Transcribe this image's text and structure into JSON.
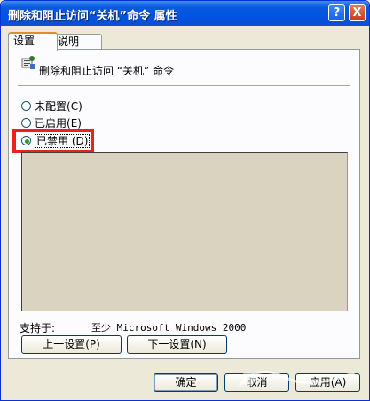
{
  "window": {
    "title": "删除和阻止访问“关机”命令 属性",
    "help_glyph": "?",
    "close_glyph": "X"
  },
  "tabs": [
    {
      "label": "设置",
      "active": true
    },
    {
      "label": "说明",
      "active": false
    }
  ],
  "policy": {
    "icon": "policy-setting-icon",
    "name": "删除和阻止访问 “关机” 命令"
  },
  "options": [
    {
      "label": "未配置",
      "accel": "(C)",
      "selected": false
    },
    {
      "label": "已启用",
      "accel": "(E)",
      "selected": false
    },
    {
      "label": "已禁用",
      "accel": "(D)",
      "selected": true
    }
  ],
  "support": {
    "label": "支持于:",
    "value": "至少 Microsoft Windows 2000"
  },
  "nav_buttons": {
    "prev": "上一设置(P)",
    "next": "下一设置(N)"
  },
  "dialog_buttons": {
    "ok": "确定",
    "cancel": "取消",
    "apply": "应用(A)"
  },
  "colors": {
    "titlebar": "#0054e3",
    "highlight": "#e8231c",
    "radio_dot": "#21a121"
  }
}
